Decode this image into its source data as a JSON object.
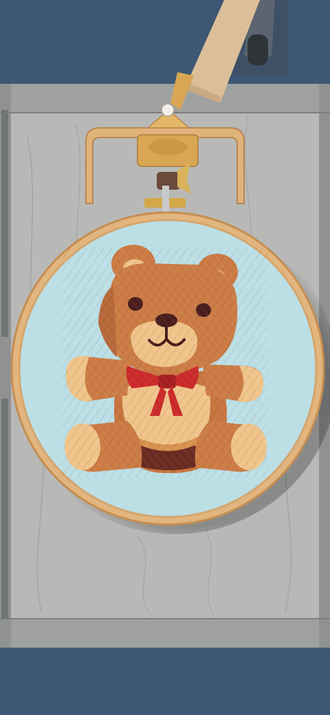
{
  "scene": {
    "colors": {
      "background": "#3e5774",
      "table_wood": "#b4b5b3",
      "table_wood_dark": "#8d8f90",
      "fabric": "#bcdfe6",
      "hoop_wood": "#e2b57e",
      "hoop_edge": "#c58e52",
      "brass": "#e3b766",
      "bear_fur": "#cc7c45",
      "bear_light": "#f0c48a",
      "bear_dark": "#6b2b22",
      "bow": "#cc2b2b",
      "arm_wood": "#dcbf9a"
    },
    "icons": {
      "stand": "embroidery-stand-icon",
      "hoop": "embroidery-hoop-icon",
      "bear": "teddy-bear-embroidery-icon"
    }
  }
}
